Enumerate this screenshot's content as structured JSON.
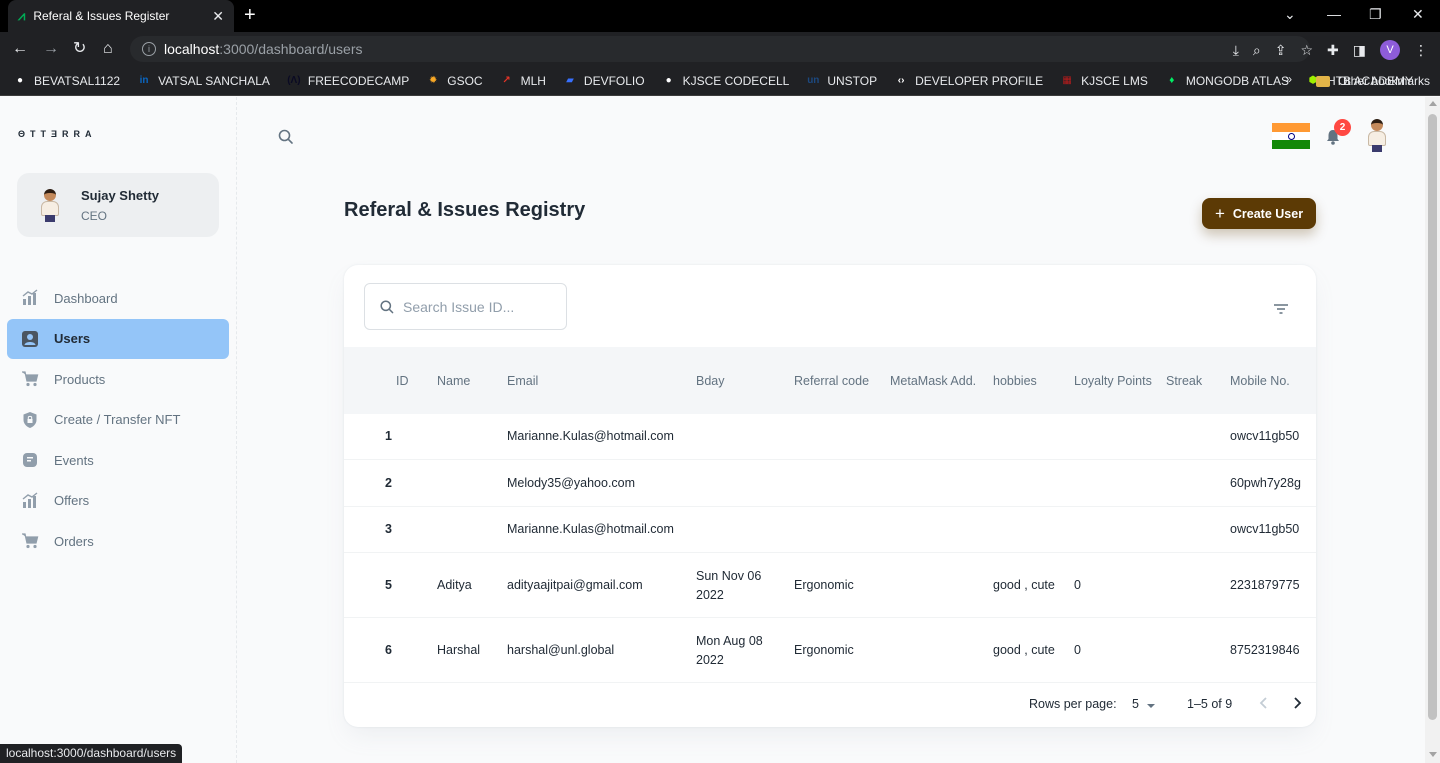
{
  "browser": {
    "tab_title": "Referal & Issues Register",
    "tab_close": "✕",
    "new_tab": "+",
    "url_host": "localhost",
    "url_rest": ":3000/dashboard/users",
    "bookmarks": [
      {
        "label": "BEVATSAL1122",
        "icon": "github-icon",
        "color": "#ffffff",
        "glyph": "●"
      },
      {
        "label": "VATSAL SANCHALA",
        "icon": "linkedin-icon",
        "color": "#0a66c2",
        "glyph": "in"
      },
      {
        "label": "FREECODECAMP",
        "icon": "freecodecamp-icon",
        "color": "#0a0a23",
        "glyph": "(Λ)"
      },
      {
        "label": "GSOC",
        "icon": "gsoc-icon",
        "color": "#f9a825",
        "glyph": "✹"
      },
      {
        "label": "MLH",
        "icon": "mlh-icon",
        "color": "#e73427",
        "glyph": "↗"
      },
      {
        "label": "DEVFOLIO",
        "icon": "devfolio-icon",
        "color": "#3770ff",
        "glyph": "▰"
      },
      {
        "label": "KJSCE CODECELL",
        "icon": "github-icon",
        "color": "#ffffff",
        "glyph": "●"
      },
      {
        "label": "UNSTOP",
        "icon": "unstop-icon",
        "color": "#1c4980",
        "glyph": "un"
      },
      {
        "label": "DEVELOPER PROFILE",
        "icon": "google-dev-icon",
        "color": "#ffffff",
        "glyph": "‹›"
      },
      {
        "label": "KJSCE LMS",
        "icon": "lms-icon",
        "color": "#b71c1c",
        "glyph": "▦"
      },
      {
        "label": "MONGODB ATLAS",
        "icon": "mongodb-icon",
        "color": "#00ed64",
        "glyph": "♦"
      },
      {
        "label": "HTB ACADEMY",
        "icon": "htb-icon",
        "color": "#9fef00",
        "glyph": "⬢"
      }
    ],
    "more_bookmarks": "»",
    "other_bookmarks": "Other bookmarks",
    "profile_initial": "V",
    "status_url": "localhost:3000/dashboard/users"
  },
  "sidebar": {
    "logo": "ΘTTƎRRA",
    "profile": {
      "name": "Sujay Shetty",
      "role": "CEO"
    },
    "items": [
      {
        "label": "Dashboard",
        "icon": "dashboard-chart-icon",
        "active": false
      },
      {
        "label": "Users",
        "icon": "user-icon",
        "active": true
      },
      {
        "label": "Products",
        "icon": "cart-icon",
        "active": false
      },
      {
        "label": "Create / Transfer NFT",
        "icon": "lock-icon",
        "active": false
      },
      {
        "label": "Events",
        "icon": "events-icon",
        "active": false
      },
      {
        "label": "Offers",
        "icon": "offers-chart-icon",
        "active": false
      },
      {
        "label": "Orders",
        "icon": "cart-icon",
        "active": false
      }
    ]
  },
  "header": {
    "notification_count": "2"
  },
  "main": {
    "title": "Referal & Issues Registry",
    "create_button": "Create User",
    "search_placeholder": "Search Issue ID...",
    "columns": [
      {
        "key": "id",
        "label": "ID"
      },
      {
        "key": "name",
        "label": "Name"
      },
      {
        "key": "email",
        "label": "Email"
      },
      {
        "key": "bday",
        "label": "Bday"
      },
      {
        "key": "referral",
        "label": "Referral code"
      },
      {
        "key": "metamask",
        "label": "MetaMask Add."
      },
      {
        "key": "hobbies",
        "label": "hobbies"
      },
      {
        "key": "loyalty",
        "label": "Loyalty Points"
      },
      {
        "key": "streak",
        "label": "Streak"
      },
      {
        "key": "mobile",
        "label": "Mobile No."
      }
    ],
    "rows": [
      {
        "id": "1",
        "name": "",
        "email": "Marianne.Kulas@hotmail.com",
        "bday": "",
        "referral": "",
        "metamask": "",
        "hobbies": "",
        "loyalty": "",
        "streak": "",
        "mobile": "owcv11gb50"
      },
      {
        "id": "2",
        "name": "",
        "email": "Melody35@yahoo.com",
        "bday": "",
        "referral": "",
        "metamask": "",
        "hobbies": "",
        "loyalty": "",
        "streak": "",
        "mobile": "60pwh7y28g"
      },
      {
        "id": "3",
        "name": "",
        "email": "Marianne.Kulas@hotmail.com",
        "bday": "",
        "referral": "",
        "metamask": "",
        "hobbies": "",
        "loyalty": "",
        "streak": "",
        "mobile": "owcv11gb50"
      },
      {
        "id": "5",
        "name": "Aditya",
        "email": "adityaajitpai@gmail.com",
        "bday": "Sun Nov 06 2022",
        "referral": "Ergonomic",
        "metamask": "",
        "hobbies": "good , cute",
        "loyalty": "0",
        "streak": "",
        "mobile": "2231879775"
      },
      {
        "id": "6",
        "name": "Harshal",
        "email": "harshal@unl.global",
        "bday": "Mon Aug 08 2022",
        "referral": "Ergonomic",
        "metamask": "",
        "hobbies": "good , cute",
        "loyalty": "0",
        "streak": "",
        "mobile": "8752319846"
      }
    ],
    "pagination": {
      "rows_per_page_label": "Rows per page:",
      "rows_per_page": "5",
      "range": "1–5 of 9"
    }
  },
  "colors": {
    "accent": "#5c3a05",
    "active_nav": "#94c5f8",
    "badge": "#ff4842"
  }
}
